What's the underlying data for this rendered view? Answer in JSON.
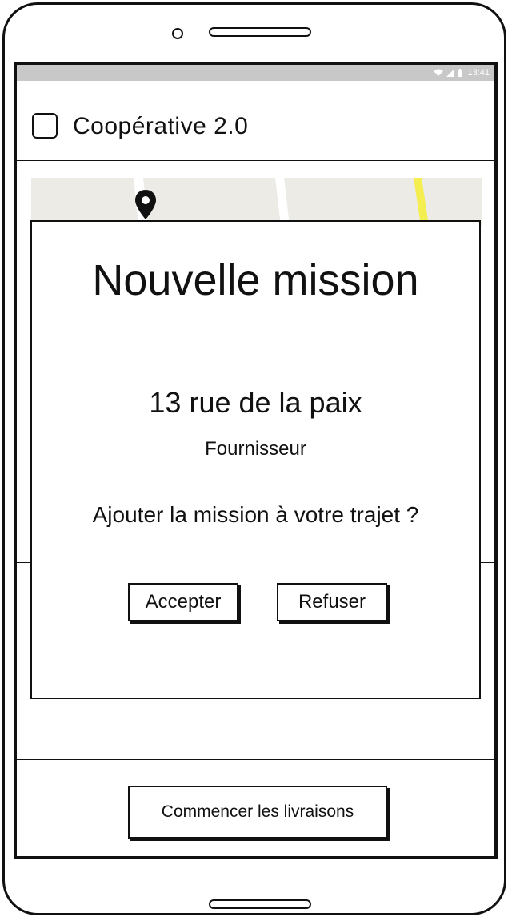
{
  "status_bar": {
    "time": "13:41"
  },
  "app_bar": {
    "title": "Coopérative 2.0"
  },
  "dialog": {
    "title": "Nouvelle mission",
    "address": "13 rue de la paix",
    "role": "Fournisseur",
    "question": "Ajouter la mission à votre trajet ?",
    "accept_label": "Accepter",
    "refuse_label": "Refuser"
  },
  "footer": {
    "start_label": "Commencer les livraisons"
  },
  "icons": {
    "map_marker": "map-pin-icon",
    "wifi": "wifi-icon",
    "signal": "signal-icon",
    "battery": "battery-icon"
  },
  "colors": {
    "road_highlight": "#f5ee50",
    "map_background": "#ecebe6",
    "status_bar": "#c8c8c8"
  }
}
